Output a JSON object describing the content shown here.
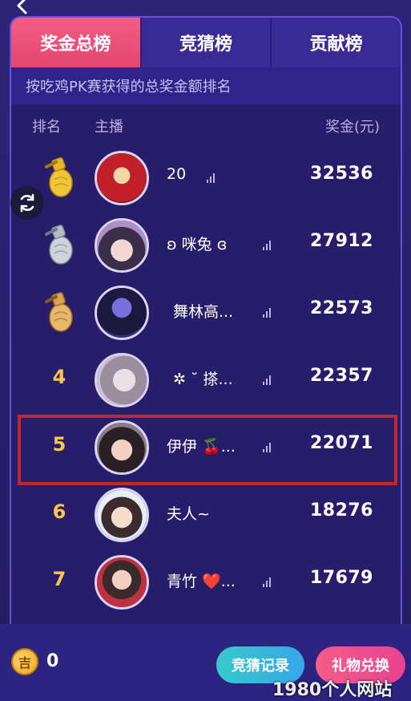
{
  "tabs": [
    {
      "label": "奖金总榜",
      "active": true
    },
    {
      "label": "竞猜榜",
      "active": false
    },
    {
      "label": "贡献榜",
      "active": false
    }
  ],
  "subtitle": "按吃鸡PK赛获得的总奖金额排名",
  "columns": {
    "rank": "排名",
    "host": "主播",
    "prize": "奖金(元)"
  },
  "rows": [
    {
      "rank": "1",
      "name": "20",
      "amount": "32536",
      "medal": "gold"
    },
    {
      "rank": "2",
      "name": "ʚ 咪兔 ɞ",
      "amount": "27912",
      "medal": "silver"
    },
    {
      "rank": "3",
      "name": "舞林高...",
      "amount": "22573",
      "medal": "bronze"
    },
    {
      "rank": "4",
      "name": "✲ ˘ 搽...",
      "amount": "22357",
      "medal": ""
    },
    {
      "rank": "5",
      "name": "伊伊 🍒...",
      "amount": "22071",
      "medal": ""
    },
    {
      "rank": "6",
      "name": "夫人~",
      "amount": "18276",
      "medal": ""
    },
    {
      "rank": "7",
      "name": "青竹 ❤️...",
      "amount": "17679",
      "medal": ""
    }
  ],
  "bottom": {
    "coin_icon_text": "吉",
    "coin_value": "0",
    "guess_record_label": "竞猜记录",
    "gift_exchange_label": "礼物兑换"
  },
  "watermark": "1980个人网站",
  "colors": {
    "active_tab": "#e44671",
    "panel": "#271d6a",
    "rank_number": "#f7c64e",
    "highlight_border": "#c0262e"
  }
}
